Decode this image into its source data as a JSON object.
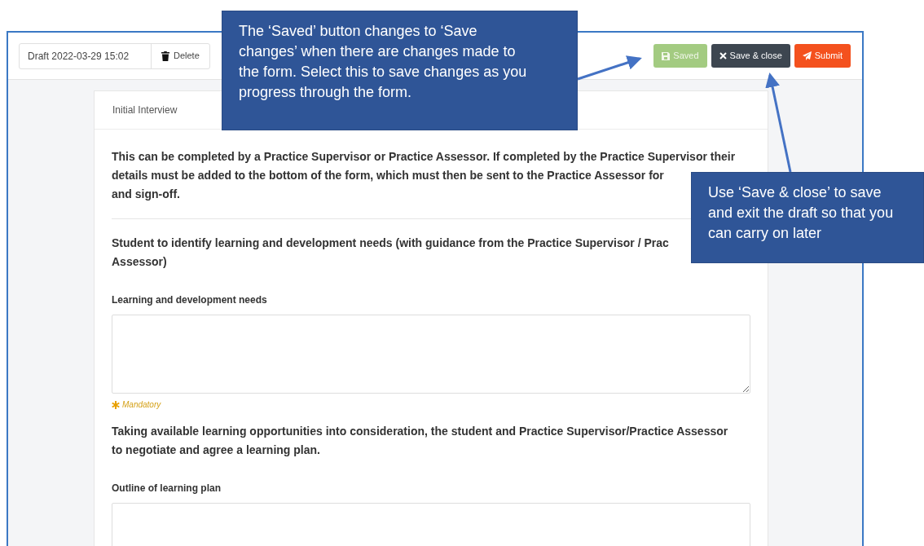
{
  "toolbar": {
    "draft": "Draft 2022-03-29 15:02",
    "delete": "Delete",
    "buttons": [
      {
        "kind": "saved",
        "label": "Saved",
        "disabled": true
      },
      {
        "kind": "close",
        "label": "Save & close",
        "disabled": false
      },
      {
        "kind": "submit",
        "label": "Submit",
        "disabled": false
      }
    ]
  },
  "form": {
    "title": "Initial Interview",
    "blocks": [
      {
        "kind": "paragraph",
        "lines": [
          "This can be completed by a Practice Supervisor or Practice Assessor. If completed by the Practice Supervisor their",
          "details must be added to the bottom of the form, which must then be sent to the Practice Assessor for",
          "and sign-off."
        ]
      },
      {
        "kind": "rule"
      },
      {
        "kind": "paragraph",
        "lines": [
          "Student to identify learning and development needs (with guidance from the Practice Supervisor / Prac",
          "Assessor)"
        ]
      },
      {
        "kind": "field",
        "label": "Learning and development needs",
        "note": "Mandatory"
      },
      {
        "kind": "paragraph",
        "lines": [
          "Taking available learning opportunities into consideration, the student and Practice Supervisor/Practice Assessor",
          "to negotiate and agree a learning plan."
        ]
      },
      {
        "kind": "field",
        "label": "Outline of learning plan"
      }
    ]
  },
  "callouts": [
    {
      "text": "The ‘Saved’ button changes to ‘Save changes’ when there are changes made to the form. Select this to save changes as you progress through the form."
    },
    {
      "text": "Use ‘Save & close’ to save and exit the draft so that you can carry on later"
    }
  ]
}
